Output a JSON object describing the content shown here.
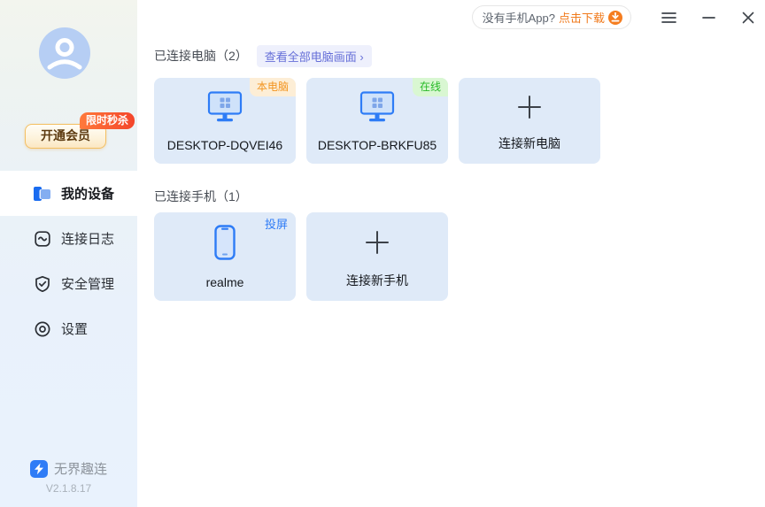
{
  "app": {
    "name": "无界趣连",
    "version": "V2.1.8.17"
  },
  "colors": {
    "accent_blue": "#2f7cf6",
    "brand_orange": "#f57d20",
    "online_green": "#27ba27",
    "link_purple": "#666fd8",
    "card_bg": "#dfeaf8"
  },
  "titlebar": {
    "download_prompt": "没有手机App?",
    "download_action": "点击下载",
    "icons": [
      "download-icon",
      "menu-icon",
      "minimize-icon",
      "close-icon"
    ]
  },
  "sidebar": {
    "vip": {
      "badge": "限时秒杀",
      "button": "开通会员"
    },
    "menu": [
      {
        "label": "我的设备",
        "icon": "devices-icon",
        "active": true
      },
      {
        "label": "连接日志",
        "icon": "log-icon",
        "active": false
      },
      {
        "label": "安全管理",
        "icon": "security-shield-icon",
        "active": false
      },
      {
        "label": "设置",
        "icon": "settings-icon",
        "active": false
      }
    ]
  },
  "sections": {
    "computers": {
      "title": "已连接电脑（2）",
      "link": "查看全部电脑画面 ›"
    },
    "phones": {
      "title": "已连接手机（1）"
    }
  },
  "cards": {
    "computer1": {
      "name": "DESKTOP-DQVEI46",
      "badge": "本电脑",
      "icon": "monitor-icon"
    },
    "computer2": {
      "name": "DESKTOP-BRKFU85",
      "badge": "在线",
      "icon": "monitor-icon"
    },
    "add_computer": {
      "label": "连接新电脑",
      "icon": "plus-icon"
    },
    "phone1": {
      "name": "realme",
      "badge": "投屏",
      "icon": "phone-icon"
    },
    "add_phone": {
      "label": "连接新手机",
      "icon": "plus-icon"
    }
  }
}
